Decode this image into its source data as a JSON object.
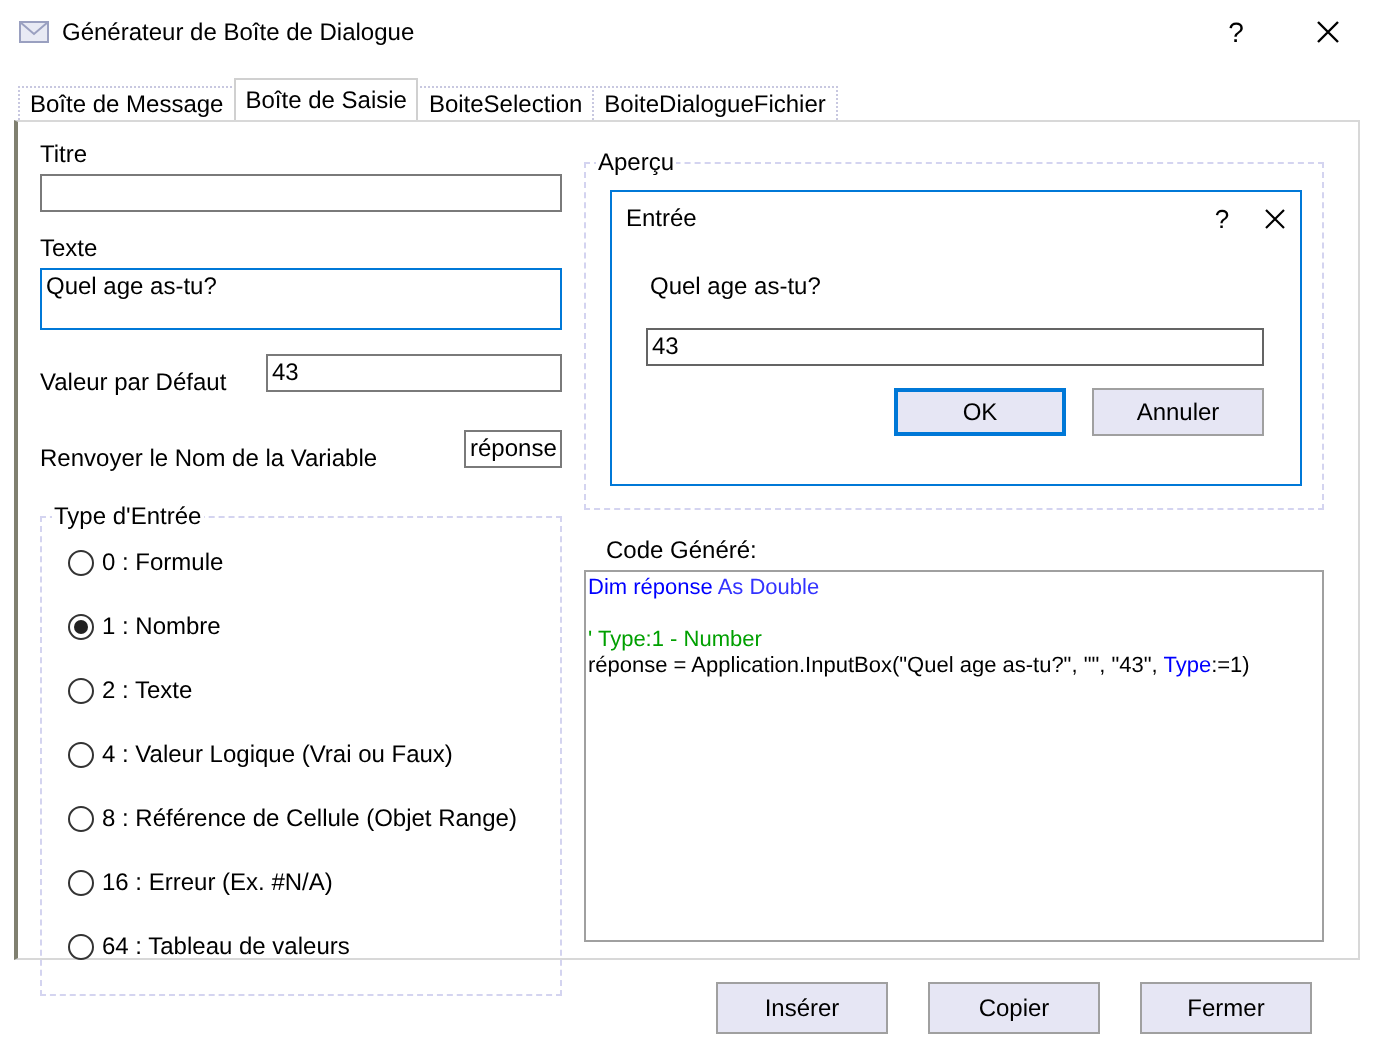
{
  "window": {
    "title": "Générateur de Boîte de Dialogue",
    "help": "?"
  },
  "tabs": [
    {
      "label": "Boîte de Message",
      "selected": false
    },
    {
      "label": "Boîte de Saisie",
      "selected": true
    },
    {
      "label": "BoiteSelection",
      "selected": false
    },
    {
      "label": "BoiteDialogueFichier",
      "selected": false
    }
  ],
  "form": {
    "title_label": "Titre",
    "text_label": "Texte",
    "text_value": "Quel age as-tu?",
    "default_label": "Valeur par Défaut",
    "default_value": "43",
    "varname_label": "Renvoyer le Nom de la Variable",
    "varname_value": "réponse"
  },
  "input_type": {
    "label": "Type d'Entrée",
    "options": [
      {
        "label": "0 : Formule",
        "selected": false
      },
      {
        "label": "1 : Nombre",
        "selected": true
      },
      {
        "label": "2 : Texte",
        "selected": false
      },
      {
        "label": "4 : Valeur Logique (Vrai ou Faux)",
        "selected": false
      },
      {
        "label": "8 : Référence de Cellule (Objet Range)",
        "selected": false
      },
      {
        "label": "16 : Erreur (Ex. #N/A)",
        "selected": false
      },
      {
        "label": "64 : Tableau de valeurs",
        "selected": false
      }
    ]
  },
  "preview": {
    "label": "Aperçu",
    "dialog": {
      "title": "Entrée",
      "help": "?",
      "prompt": "Quel age as-tu?",
      "value": "43",
      "buttons": [
        {
          "label": "OK",
          "default": true
        },
        {
          "label": "Annuler",
          "default": false
        }
      ]
    }
  },
  "code": {
    "label": "Code Généré:",
    "lines": [
      {
        "kind": "code",
        "segments": [
          {
            "kind": "keyword",
            "text": "Dim réponse "
          },
          {
            "kind": "type",
            "text": "As Double"
          }
        ]
      },
      {
        "kind": "blank"
      },
      {
        "kind": "code",
        "segments": [
          {
            "kind": "comment",
            "text": "' Type:1 - Number"
          }
        ]
      },
      {
        "kind": "code",
        "segments": [
          {
            "kind": "plain",
            "text": "réponse = Application.InputBox(\"Quel age as-tu?\", \"\", \"43\", "
          },
          {
            "kind": "keyword",
            "text": "Type"
          },
          {
            "kind": "plain",
            "text": ":=1)"
          }
        ]
      }
    ]
  },
  "buttons": [
    "Insérer",
    "Copier",
    "Fermer"
  ]
}
